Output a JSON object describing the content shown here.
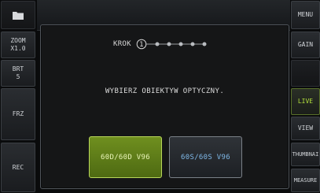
{
  "left_panel": {
    "folder_icon": "folder-icon",
    "zoom_label": "ZOOM\nX1.0",
    "brt_label": "BRT\n5",
    "frz_label": "FRZ",
    "rec_label": "REC"
  },
  "right_panel": {
    "menu_label": "MENU",
    "gain_label": "GAIN",
    "live_label": "LIVE",
    "view_label": "VIEW",
    "thumbnail_label": "THUMBNAI",
    "measure_label": "MEASURE"
  },
  "dialog": {
    "step_label": "KROK",
    "step_current": "1",
    "step_total": 6,
    "prompt": "WYBIERZ OBIEKTYW OPTYCZNY.",
    "option1": "60D/60D V96",
    "option2": "60S/60S V96"
  },
  "colors": {
    "accent": "#b6e33d",
    "selected_option": "#6f8f1f",
    "option2_text": "#7fb8e8"
  }
}
